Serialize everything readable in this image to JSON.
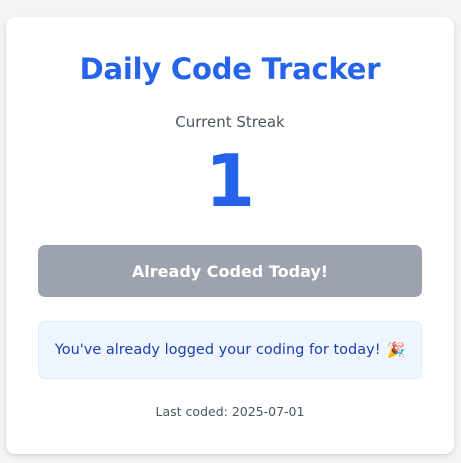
{
  "tracker": {
    "title": "Daily Code Tracker",
    "streak_label": "Current Streak",
    "streak_value": "1",
    "button_label": "Already Coded Today!",
    "message": "You've already logged your coding for today!",
    "message_icon": "🎉",
    "last_coded_label": "Last coded: ",
    "last_coded_date": "2025-07-01"
  },
  "colors": {
    "accent": "#2563eb",
    "button_disabled": "#9ca3af",
    "message_bg": "#eff6ff",
    "message_text": "#1e40af",
    "page_bg": "#f3f4f6"
  },
  "icons": {
    "message_icon_name": "party-popper-icon"
  }
}
